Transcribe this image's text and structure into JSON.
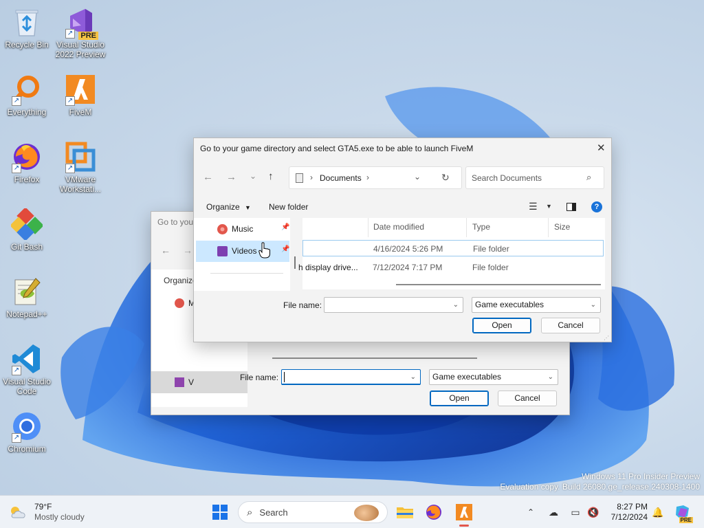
{
  "desktop": {
    "icons": [
      {
        "label": "Recycle Bin",
        "icon": "recycle-bin-icon"
      },
      {
        "label": "Visual Studio 2022 Preview",
        "icon": "visual-studio-preview-icon",
        "badge": "PRE"
      },
      {
        "label": "Everything",
        "icon": "everything-search-icon"
      },
      {
        "label": "FiveM",
        "icon": "fivem-icon"
      },
      {
        "label": "Firefox",
        "icon": "firefox-icon"
      },
      {
        "label": "VMware Workstati...",
        "icon": "vmware-icon"
      },
      {
        "label": "Git Bash",
        "icon": "git-bash-icon"
      },
      {
        "label": "Notepad++",
        "icon": "notepadpp-icon"
      },
      {
        "label": "Visual Studio Code",
        "icon": "vscode-icon"
      },
      {
        "label": "Chromium",
        "icon": "chromium-icon"
      }
    ],
    "watermark": {
      "line1": "Windows 11 Pro Insider Preview",
      "line2": "Evaluation copy. Build 26080.ge_release.240308-1400"
    }
  },
  "back_dialog": {
    "title": "Go to you",
    "organize": "Organize",
    "nav_items": [
      "M",
      "V"
    ],
    "file_name_label": "File name:",
    "file_name_value": "",
    "filter": "Game executables",
    "open_label": "Open",
    "cancel_label": "Cancel"
  },
  "front_dialog": {
    "title": "Go to your game directory and select GTA5.exe to be able to launch FiveM",
    "address": {
      "segment": "Documents"
    },
    "search_placeholder": "Search Documents",
    "toolbar": {
      "organize": "Organize",
      "new_folder": "New folder"
    },
    "nav_pane": [
      {
        "label": "Music",
        "icon": "music-icon"
      },
      {
        "label": "Videos",
        "icon": "videos-icon",
        "selected": true
      }
    ],
    "columns": [
      "Date modified",
      "Type",
      "Size"
    ],
    "rows": [
      {
        "name": "",
        "date": "4/16/2024 5:26 PM",
        "type": "File folder",
        "selected": true
      },
      {
        "name": "h display drive...",
        "date": "7/12/2024 7:17 PM",
        "type": "File folder",
        "selected": false
      }
    ],
    "file_name_label": "File name:",
    "file_name_value": "",
    "filter": "Game executables",
    "open_label": "Open",
    "cancel_label": "Cancel"
  },
  "taskbar": {
    "weather": {
      "temp": "79°F",
      "desc": "Mostly cloudy"
    },
    "search_label": "Search",
    "clock": {
      "time": "8:27 PM",
      "date": "7/12/2024"
    },
    "badge": "PRE"
  },
  "colors": {
    "accent": "#0067c0",
    "selection": "#cce8ff",
    "bloom": "#1f5fd6"
  }
}
